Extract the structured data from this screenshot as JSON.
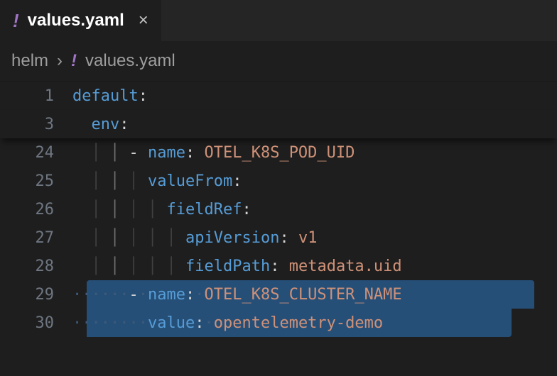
{
  "tab": {
    "icon": "!",
    "filename": "values.yaml",
    "close_glyph": "×"
  },
  "breadcrumb": {
    "segments": [
      "helm"
    ],
    "file_icon": "!",
    "filename": "values.yaml",
    "separator": "›"
  },
  "lines": [
    {
      "num": "1",
      "tokens": [
        {
          "t": "default",
          "c": "key"
        },
        {
          "t": ":",
          "c": "punct"
        }
      ],
      "indent_spaces": 0,
      "guides": [],
      "hl": false
    },
    {
      "num": "3",
      "tokens": [
        {
          "t": "env",
          "c": "key"
        },
        {
          "t": ":",
          "c": "punct"
        }
      ],
      "indent_spaces": 2,
      "guides": [],
      "hl": false
    },
    {
      "num": "24",
      "tokens": [
        {
          "t": "- ",
          "c": "dash"
        },
        {
          "t": "name",
          "c": "key"
        },
        {
          "t": ": ",
          "c": "punct"
        },
        {
          "t": "OTEL_K8S_POD_UID",
          "c": "str"
        }
      ],
      "indent_spaces": 6,
      "guides": [
        2,
        4
      ],
      "hl": false
    },
    {
      "num": "25",
      "tokens": [
        {
          "t": "valueFrom",
          "c": "key"
        },
        {
          "t": ":",
          "c": "punct"
        }
      ],
      "indent_spaces": 8,
      "guides": [
        2,
        4,
        6
      ],
      "hl": false
    },
    {
      "num": "26",
      "tokens": [
        {
          "t": "fieldRef",
          "c": "key"
        },
        {
          "t": ":",
          "c": "punct"
        }
      ],
      "indent_spaces": 10,
      "guides": [
        2,
        4,
        6,
        8
      ],
      "hl": false
    },
    {
      "num": "27",
      "tokens": [
        {
          "t": "apiVersion",
          "c": "key"
        },
        {
          "t": ": ",
          "c": "punct"
        },
        {
          "t": "v1",
          "c": "str"
        }
      ],
      "indent_spaces": 12,
      "guides": [
        2,
        4,
        6,
        8,
        10
      ],
      "hl": false
    },
    {
      "num": "28",
      "tokens": [
        {
          "t": "fieldPath",
          "c": "key"
        },
        {
          "t": ": ",
          "c": "punct"
        },
        {
          "t": "metadata.uid",
          "c": "str"
        }
      ],
      "indent_spaces": 12,
      "guides": [
        2,
        4,
        6,
        8,
        10
      ],
      "hl": false
    },
    {
      "num": "29",
      "tokens": [
        {
          "t": "- ",
          "c": "dash"
        },
        {
          "t": "name",
          "c": "key"
        },
        {
          "t": ": ",
          "c": "punct"
        },
        {
          "t": "OTEL_K8S_CLUSTER_NAME",
          "c": "str"
        }
      ],
      "indent_spaces": 6,
      "guides": [
        2,
        4
      ],
      "hl": true,
      "hlwidth": 630
    },
    {
      "num": "30",
      "tokens": [
        {
          "t": "value",
          "c": "key"
        },
        {
          "t": ": ",
          "c": "punct"
        },
        {
          "t": "opentelemetry-demo",
          "c": "str"
        }
      ],
      "indent_spaces": 8,
      "guides": [
        2,
        4,
        6
      ],
      "hl": true,
      "hlwidth": 598
    }
  ],
  "sticky_count": 2
}
